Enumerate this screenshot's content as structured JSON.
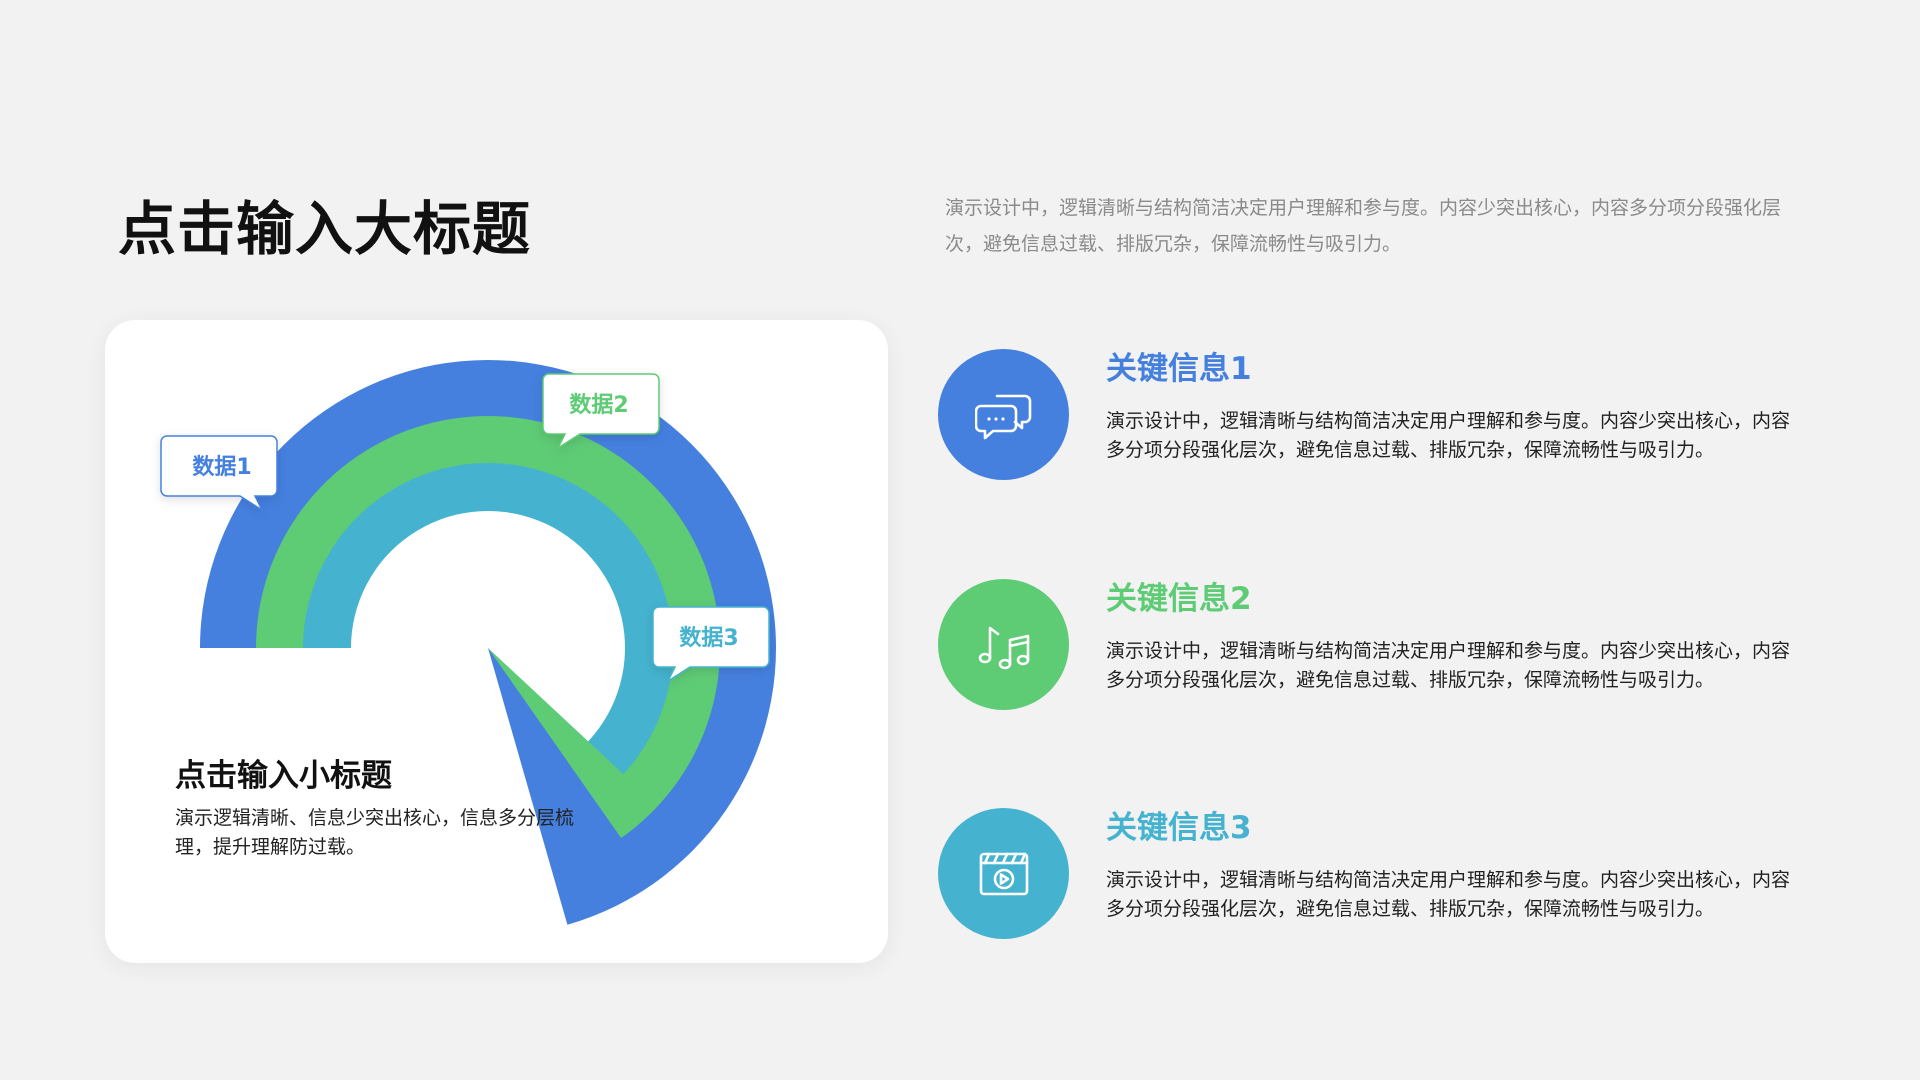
{
  "header": {
    "title": "点击输入大标题",
    "intro": "演示设计中，逻辑清晰与结构简洁决定用户理解和参与度。内容少突出核心，内容多分项分段强化层次，避免信息过载、排版冗杂，保障流畅性与吸引力。"
  },
  "chart_card": {
    "labels": [
      "数据1",
      "数据2",
      "数据3"
    ],
    "sub_title": "点击输入小标题",
    "sub_desc": "演示逻辑清晰、信息少突出核心，信息多分层梳理，提升理解防过载。",
    "colors": [
      "#4580df",
      "#5ecb75",
      "#45b3cf"
    ]
  },
  "info_items": [
    {
      "title": "关键信息1",
      "desc": "演示设计中，逻辑清晰与结构简洁决定用户理解和参与度。内容少突出核心，内容多分项分段强化层次，避免信息过载、排版冗杂，保障流畅性与吸引力。",
      "color": "#4580df",
      "icon": "chat-bubbles-icon"
    },
    {
      "title": "关键信息2",
      "desc": "演示设计中，逻辑清晰与结构简洁决定用户理解和参与度。内容少突出核心，内容多分项分段强化层次，避免信息过载、排版冗杂，保障流畅性与吸引力。",
      "color": "#5ecb75",
      "icon": "music-notes-icon"
    },
    {
      "title": "关键信息3",
      "desc": "演示设计中，逻辑清晰与结构简洁决定用户理解和参与度。内容少突出核心，内容多分项分段强化层次，避免信息过载、排版冗杂，保障流畅性与吸引力。",
      "color": "#45b3cf",
      "icon": "video-clapper-icon"
    }
  ]
}
